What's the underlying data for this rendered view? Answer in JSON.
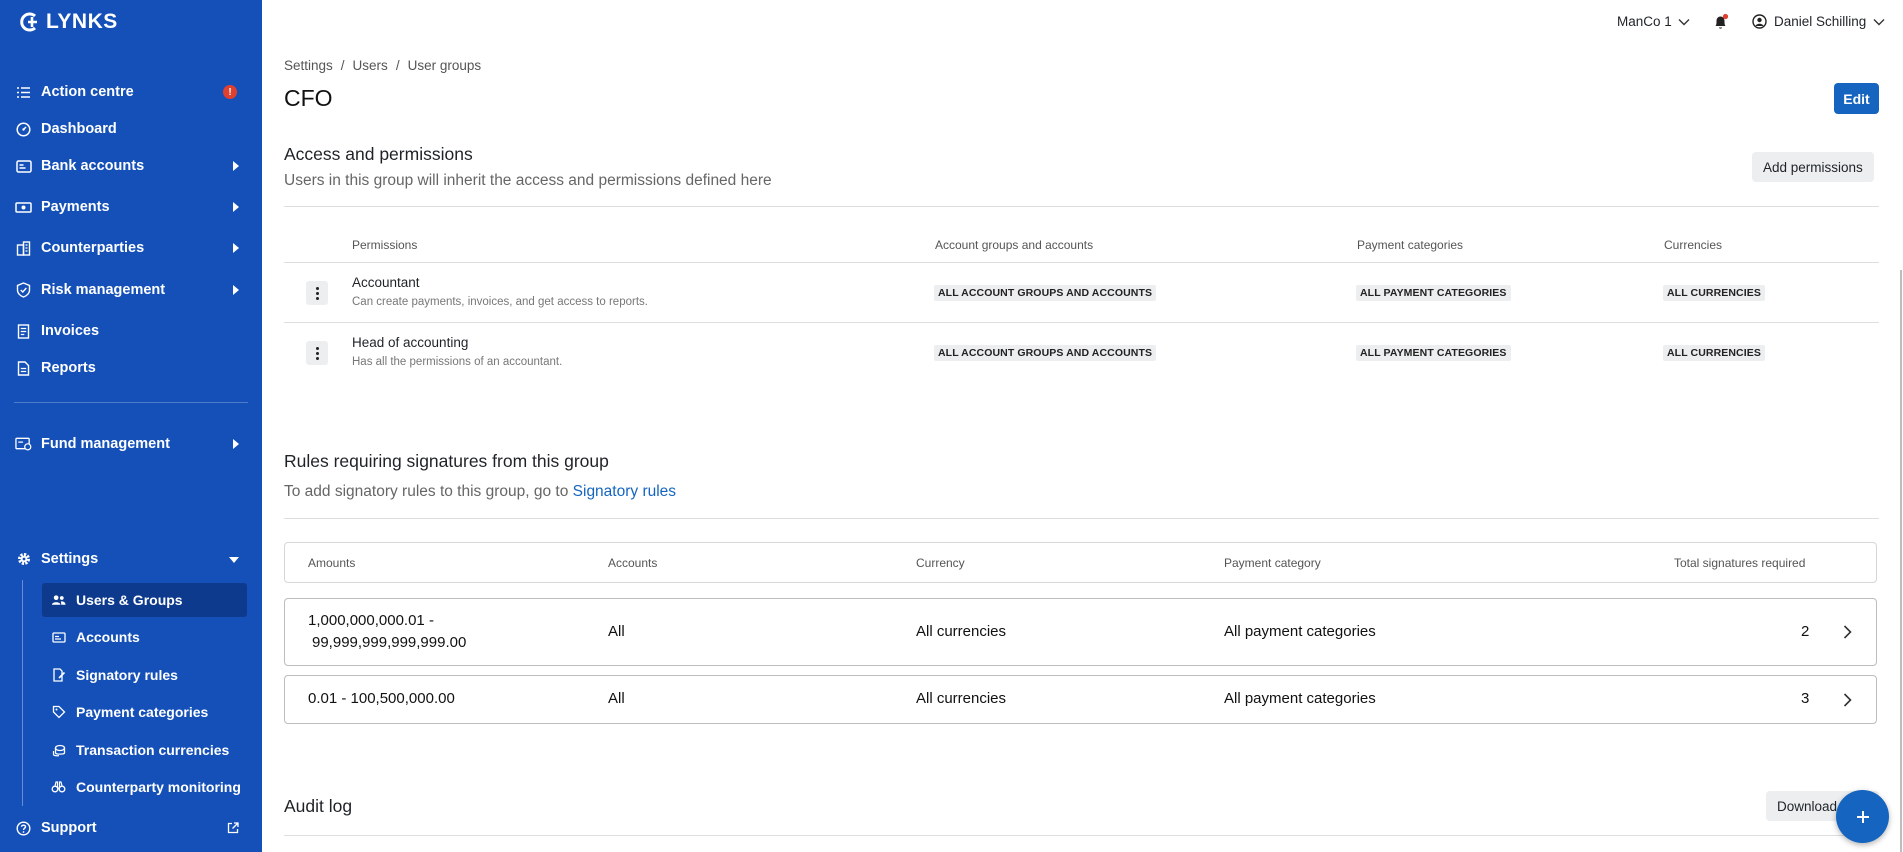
{
  "app": {
    "brand": "LYNKS"
  },
  "sidebar": {
    "items": [
      {
        "label": "Action centre",
        "badge": "!"
      },
      {
        "label": "Dashboard"
      },
      {
        "label": "Bank accounts"
      },
      {
        "label": "Payments"
      },
      {
        "label": "Counterparties"
      },
      {
        "label": "Risk management"
      },
      {
        "label": "Invoices"
      },
      {
        "label": "Reports"
      },
      {
        "label": "Fund management"
      },
      {
        "label": "Settings"
      },
      {
        "label": "Support"
      }
    ],
    "settings_items": [
      {
        "label": "Users & Groups"
      },
      {
        "label": "Accounts"
      },
      {
        "label": "Signatory rules"
      },
      {
        "label": "Payment categories"
      },
      {
        "label": "Transaction currencies"
      },
      {
        "label": "Counterparty monitoring"
      }
    ]
  },
  "topbar": {
    "company": "ManCo 1",
    "user": "Daniel Schilling"
  },
  "breadcrumb": [
    "Settings",
    "Users",
    "User groups"
  ],
  "page": {
    "title": "CFO",
    "edit_label": "Edit"
  },
  "access": {
    "title": "Access and permissions",
    "subtitle": "Users in this group will inherit the access and permissions defined here",
    "add_label": "Add permissions",
    "columns": [
      "Permissions",
      "Account groups and accounts",
      "Payment categories",
      "Currencies"
    ],
    "rows": [
      {
        "name": "Accountant",
        "desc": "Can create payments, invoices, and get access to reports.",
        "accounts": "ALL ACCOUNT GROUPS AND ACCOUNTS",
        "categories": "ALL PAYMENT CATEGORIES",
        "currencies": "ALL CURRENCIES"
      },
      {
        "name": "Head of accounting",
        "desc": "Has all the permissions of an accountant.",
        "accounts": "ALL ACCOUNT GROUPS AND ACCOUNTS",
        "categories": "ALL PAYMENT CATEGORIES",
        "currencies": "ALL CURRENCIES"
      }
    ]
  },
  "rules": {
    "title": "Rules requiring signatures from this group",
    "subtitle_prefix": "To add signatory rules to this group, go to",
    "subtitle_link": "Signatory rules",
    "columns": [
      "Amounts",
      "Accounts",
      "Currency",
      "Payment category",
      "Total signatures required"
    ],
    "rows": [
      {
        "amount_line1": "1,000,000,000.01 -",
        "amount_line2": "99,999,999,999,999.00",
        "accounts": "All",
        "currency": "All currencies",
        "category": "All payment categories",
        "signatures": "2"
      },
      {
        "amount_line1": "0.01 - 100,500,000.00",
        "amount_line2": "",
        "accounts": "All",
        "currency": "All currencies",
        "category": "All payment categories",
        "signatures": "3"
      }
    ]
  },
  "audit": {
    "title": "Audit log",
    "download_label": "Download"
  },
  "colors": {
    "sidebar": "#1450b8",
    "primary": "#1565c0",
    "badge": "#e0412f"
  }
}
